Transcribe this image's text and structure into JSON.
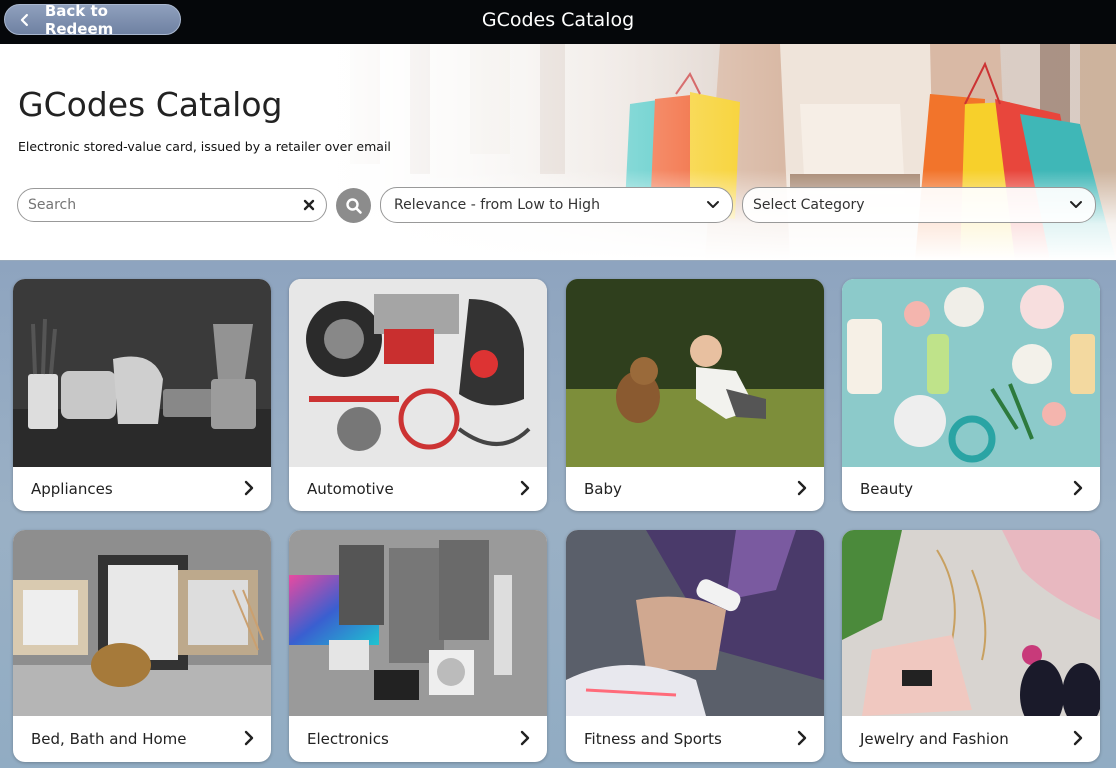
{
  "topbar": {
    "back_label": "Back to Redeem",
    "title": "GCodes Catalog"
  },
  "hero": {
    "title": "GCodes Catalog",
    "subtitle": "Electronic stored-value card, issued by a retailer over email"
  },
  "search": {
    "placeholder": "Search",
    "value": ""
  },
  "sort": {
    "selected": "Relevance - from Low to High"
  },
  "category_select": {
    "selected": "Select Category"
  },
  "categories": [
    {
      "label": "Appliances"
    },
    {
      "label": "Automotive"
    },
    {
      "label": "Baby"
    },
    {
      "label": "Beauty"
    },
    {
      "label": "Bed, Bath and Home"
    },
    {
      "label": "Electronics"
    },
    {
      "label": "Fitness and Sports"
    },
    {
      "label": "Jewelry and Fashion"
    }
  ],
  "colors": {
    "topbar_bg": "#05070a",
    "back_button": "#7d8fae",
    "grid_bg": "#8fa6bf",
    "search_button": "#8c8c8c"
  }
}
